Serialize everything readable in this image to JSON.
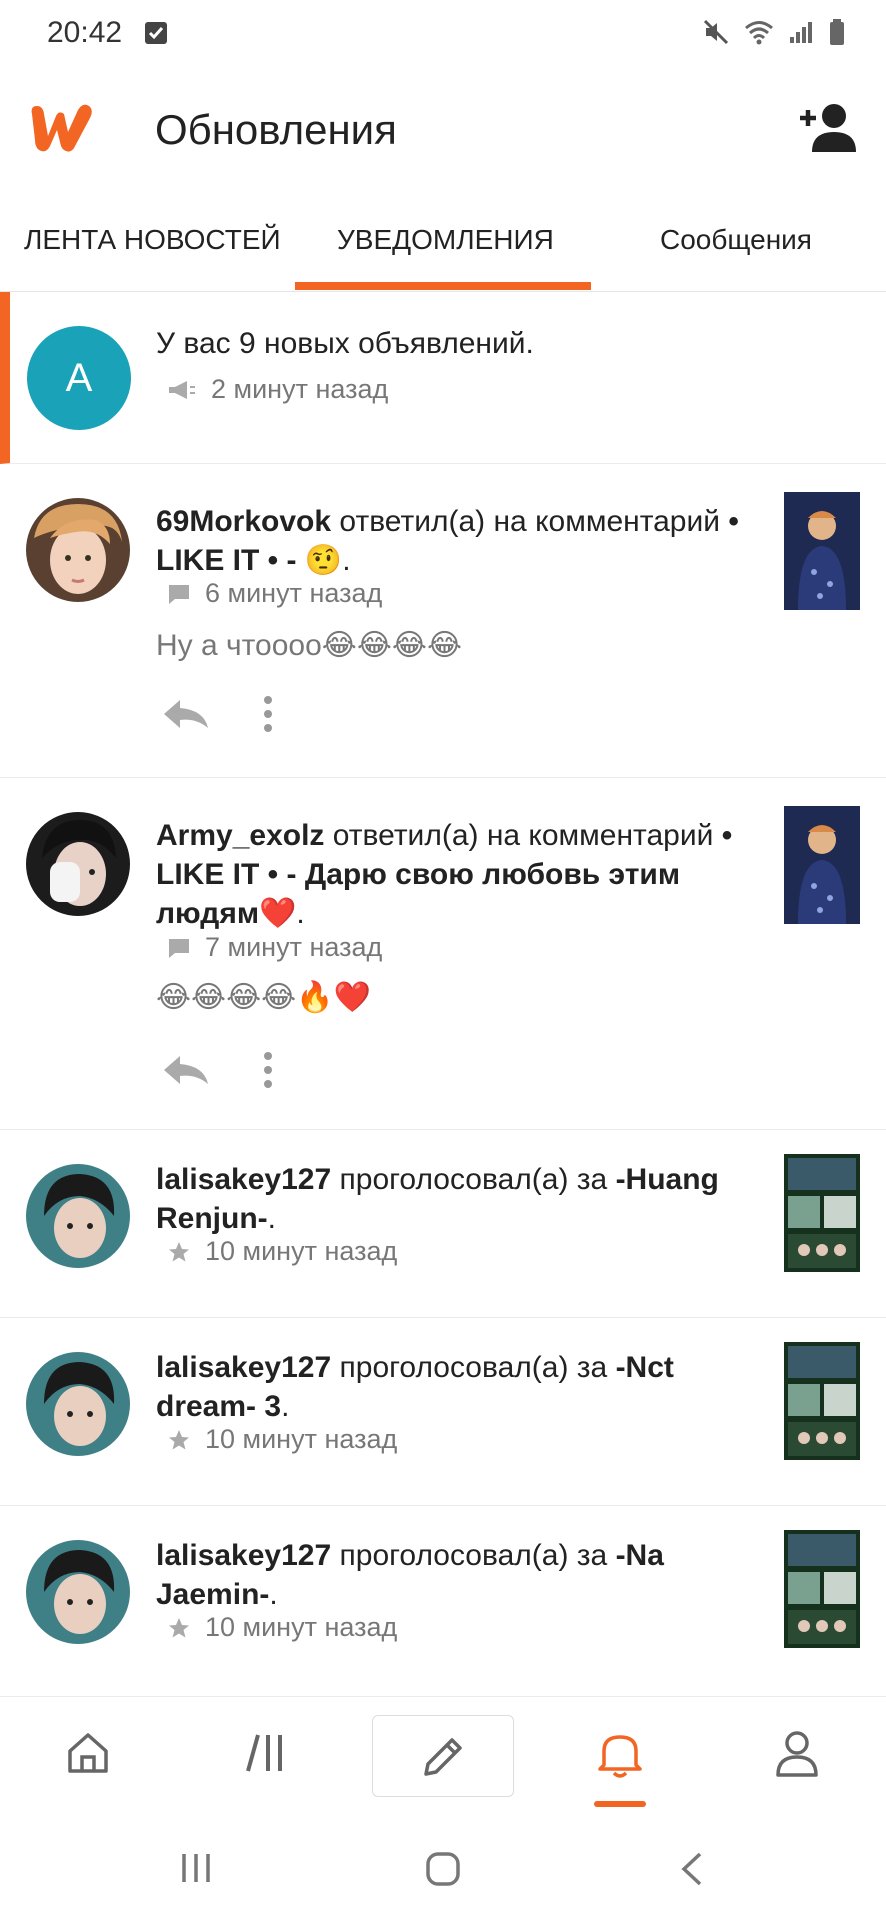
{
  "status_bar": {
    "time": "20:42"
  },
  "header": {
    "title": "Обновления"
  },
  "tabs": [
    {
      "label": "ЛЕНТА НОВОСТЕЙ",
      "active": false
    },
    {
      "label": "УВЕДОМЛЕНИЯ",
      "active": true
    },
    {
      "label": "Сообщения",
      "active": false
    }
  ],
  "notifications": [
    {
      "avatar_letter": "A",
      "text": "У вас 9 новых объявлений.",
      "time": "2 минут назад",
      "icon": "megaphone-icon"
    },
    {
      "user": "69Morkovok",
      "action": "ответил(а) на комментарий",
      "target": "• LIKE IT • - 🤨",
      "target_suffix": ".",
      "time": "6 минут назад",
      "icon": "comment-icon",
      "reply": "Ну а чтоооо😂😂😂😂"
    },
    {
      "user": "Army_exolz",
      "action": "ответил(а) на комментарий",
      "target": "• LIKE IT • - Дарю свою любовь этим людям❤️",
      "target_suffix": ".",
      "time": "7 минут назад",
      "icon": "comment-icon",
      "reply": "😂😂😂😂🔥❤️"
    },
    {
      "user": "lalisakey127",
      "action": "проголосовал(а) за",
      "target": "-Huang Renjun-",
      "target_suffix": ".",
      "time": "10 минут назад",
      "icon": "star-icon"
    },
    {
      "user": "lalisakey127",
      "action": "проголосовал(а) за",
      "target": "-Nct dream- 3",
      "target_suffix": ".",
      "time": "10 минут назад",
      "icon": "star-icon"
    },
    {
      "user": "lalisakey127",
      "action": "проголосовал(а) за",
      "target": "-Na Jaemin-",
      "target_suffix": ".",
      "time": "10 минут назад",
      "icon": "star-icon"
    }
  ],
  "colors": {
    "accent": "#f26522",
    "announce_avatar": "#1aa3b8"
  }
}
